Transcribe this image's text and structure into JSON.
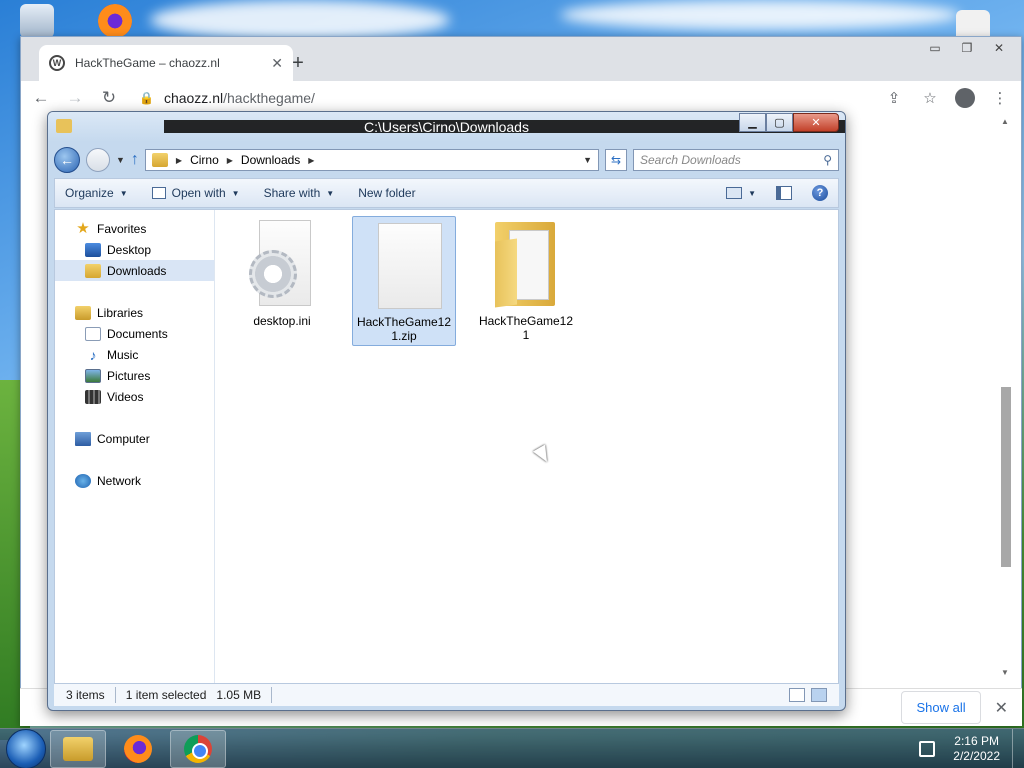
{
  "browser": {
    "tab_title": "HackTheGame – chaozz.nl",
    "tab_close": "✕",
    "new_tab": "+",
    "url_host": "chaozz.nl",
    "url_path": "/hackthegame/",
    "downloads_show_all": "Show all",
    "downloads_close": "✕"
  },
  "explorer": {
    "title": "C:\\Users\\Cirno\\Downloads",
    "breadcrumb": [
      "Cirno",
      "Downloads"
    ],
    "search_placeholder": "Search Downloads",
    "commands": {
      "organize": "Organize",
      "open_with": "Open with",
      "share_with": "Share with",
      "new_folder": "New folder"
    },
    "nav": {
      "favorites": "Favorites",
      "desktop": "Desktop",
      "downloads": "Downloads",
      "libraries": "Libraries",
      "documents": "Documents",
      "music": "Music",
      "pictures": "Pictures",
      "videos": "Videos",
      "computer": "Computer",
      "network": "Network"
    },
    "files": [
      {
        "name": "desktop.ini",
        "kind": "settings-file",
        "selected": false
      },
      {
        "name": "HackTheGame121.zip",
        "kind": "zip-file",
        "selected": true
      },
      {
        "name": "HackTheGame121",
        "kind": "folder",
        "selected": false
      }
    ],
    "status": {
      "item_count": "3 items",
      "selection": "1 item selected",
      "size": "1.05 MB"
    }
  },
  "taskbar": {
    "time": "2:16 PM",
    "date": "2/2/2022"
  }
}
